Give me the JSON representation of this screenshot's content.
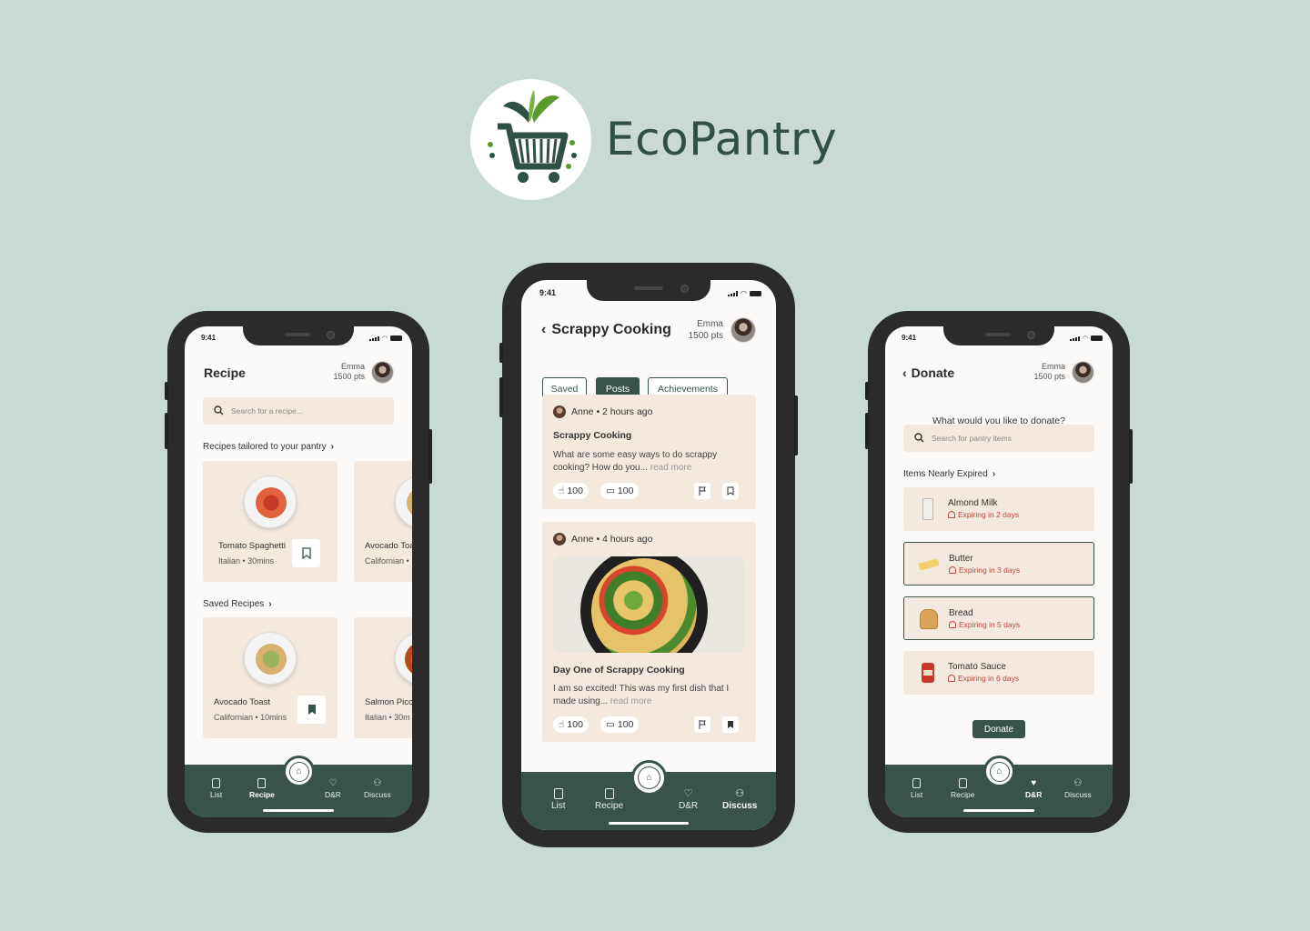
{
  "brand": {
    "name": "EcoPantry",
    "colors": {
      "primary": "#385448",
      "accent": "#f3e9df",
      "leaf": "#5a9a2f"
    }
  },
  "status": {
    "time": "9:41"
  },
  "user": {
    "name": "Emma",
    "points": "1500 pts"
  },
  "tabs": {
    "list": "List",
    "recipe": "Recipe",
    "dr": "D&R",
    "discuss": "Discuss"
  },
  "recipe_screen": {
    "title": "Recipe",
    "search_placeholder": "Search for a recipe...",
    "section_tailored": "Recipes tailored to your pantry",
    "section_saved": "Saved Recipes",
    "tailored": [
      {
        "name": "Tomato Spaghetti",
        "meta": "Italian • 30mins",
        "saved": false
      },
      {
        "name": "Avocado Toa",
        "meta": "Californian •",
        "saved": false
      }
    ],
    "saved": [
      {
        "name": "Avocado Toast",
        "meta": "Californian • 10mins",
        "saved": true
      },
      {
        "name": "Salmon Picc",
        "meta": "Italian • 30m",
        "saved": true
      }
    ],
    "active_tab": "Recipe"
  },
  "discuss_screen": {
    "title": "Scrappy Cooking",
    "filters": [
      "Saved",
      "Posts",
      "Achievements"
    ],
    "active_filter": "Posts",
    "posts": [
      {
        "author_meta": "Anne • 2 hours ago",
        "title": "Scrappy Cooking",
        "text": "What are some easy ways to do scrappy cooking? How do you...",
        "read_more": "read more",
        "likes": "100",
        "comments": "100",
        "bookmarked": false
      },
      {
        "author_meta": "Anne • 4 hours ago",
        "title": "Day One of Scrappy Cooking",
        "text": "I am so excited! This was my first dish that I made using...",
        "read_more": "read more",
        "likes": "100",
        "comments": "100",
        "bookmarked": true
      }
    ],
    "active_tab": "Discuss"
  },
  "donate_screen": {
    "title": "Donate",
    "question": "What would you like to donate?",
    "search_placeholder": "Search for pantry items",
    "section_title": "Items Nearly Expired",
    "items": [
      {
        "name": "Almond Milk",
        "expiry": "Expiring in 2 days",
        "selected": false,
        "icon": "milk-icon"
      },
      {
        "name": "Butter",
        "expiry": "Expiring in 3 days",
        "selected": true,
        "icon": "butter-icon"
      },
      {
        "name": "Bread",
        "expiry": "Expiring in 5 days",
        "selected": true,
        "icon": "bread-icon"
      },
      {
        "name": "Tomato Sauce",
        "expiry": "Expiring in 6 days",
        "selected": false,
        "icon": "tomato-sauce-icon"
      }
    ],
    "donate_button": "Donate",
    "active_tab": "D&R"
  }
}
